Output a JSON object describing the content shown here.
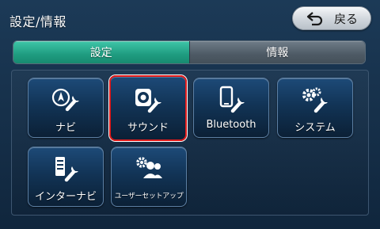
{
  "header": {
    "title": "設定/情報",
    "back_label": "戻る"
  },
  "tabs": [
    {
      "label": "設定",
      "active": true
    },
    {
      "label": "情報",
      "active": false
    }
  ],
  "menu": {
    "items": [
      {
        "label": "ナビ",
        "icon": "navi-wrench-icon",
        "selected": false
      },
      {
        "label": "サウンド",
        "icon": "speaker-wrench-icon",
        "selected": true
      },
      {
        "label": "Bluetooth",
        "icon": "phone-wrench-icon",
        "selected": false
      },
      {
        "label": "システム",
        "icon": "gears-wrench-icon",
        "selected": false
      },
      {
        "label": "インターナビ",
        "icon": "internavi-wrench-icon",
        "selected": false
      },
      {
        "label": "ユーザーセットアップ",
        "icon": "users-gear-icon",
        "selected": false
      }
    ]
  },
  "colors": {
    "active_tab": "#2bb092",
    "selection_border": "#e01a1a",
    "background": "#163049"
  }
}
